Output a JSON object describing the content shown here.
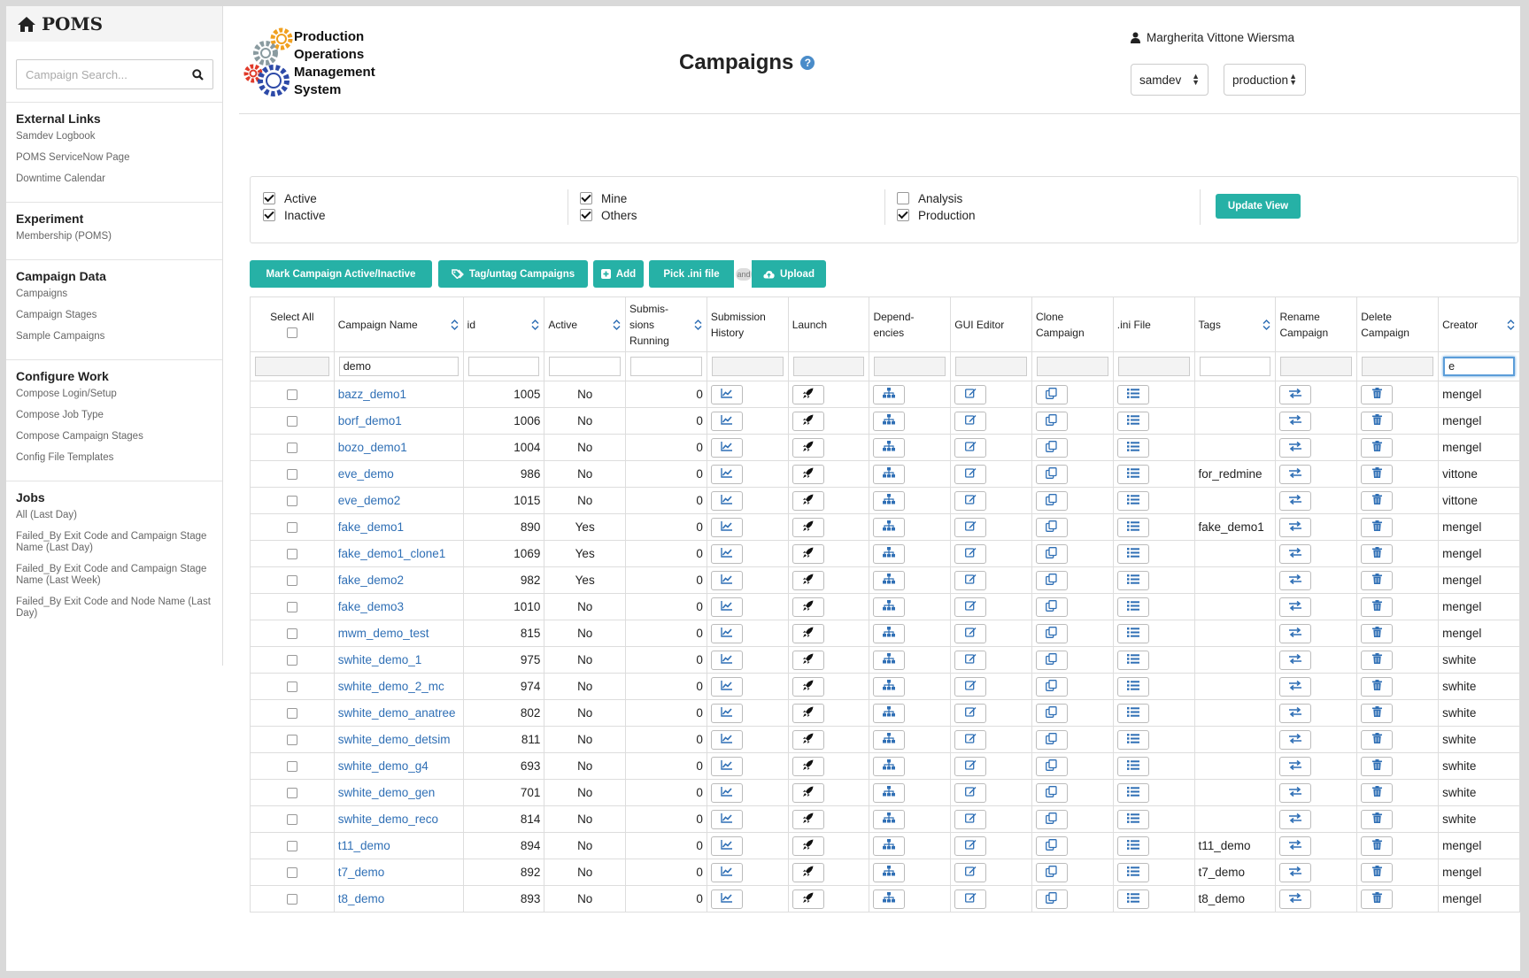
{
  "brand": {
    "title": "POMS"
  },
  "sidebar": {
    "search_placeholder": "Campaign Search...",
    "sections": [
      {
        "title": "External Links",
        "items": [
          "Samdev Logbook",
          "POMS ServiceNow Page",
          "Downtime Calendar"
        ]
      },
      {
        "title": "Experiment",
        "items": [
          "Membership (POMS)"
        ]
      },
      {
        "title": "Campaign Data",
        "items": [
          "Campaigns",
          "Campaign Stages",
          "Sample Campaigns"
        ]
      },
      {
        "title": "Configure Work",
        "items": [
          "Compose Login/Setup",
          "Compose Job Type",
          "Compose Campaign Stages",
          "Config File Templates"
        ]
      },
      {
        "title": "Jobs",
        "items": [
          "All (Last Day)",
          "Failed_By Exit Code and Campaign Stage Name (Last Day)",
          "Failed_By Exit Code and Campaign Stage Name (Last Week)",
          "Failed_By Exit Code and Node Name (Last Day)"
        ]
      }
    ]
  },
  "header": {
    "logo_lines": [
      "Production",
      "Operations",
      "Management",
      "System"
    ],
    "page_title": "Campaigns",
    "help_icon": "question-circle-icon",
    "user_name": "Margherita Vittone Wiersma",
    "experiment_select": "samdev",
    "role_select": "production"
  },
  "filters": {
    "groups": [
      [
        {
          "label": "Active",
          "checked": true
        },
        {
          "label": "Inactive",
          "checked": true
        }
      ],
      [
        {
          "label": "Mine",
          "checked": true
        },
        {
          "label": "Others",
          "checked": true
        }
      ],
      [
        {
          "label": "Analysis",
          "checked": false
        },
        {
          "label": "Production",
          "checked": true
        }
      ]
    ],
    "update_label": "Update View"
  },
  "toolbar": {
    "mark_label": "Mark Campaign Active/Inactive",
    "tag_label": "Tag/untag Campaigns",
    "add_label": "Add",
    "pick_label": "Pick .ini file",
    "and_label": "and",
    "upload_label": "Upload"
  },
  "table": {
    "headers": {
      "select_all": "Select All",
      "name": "Campaign Name",
      "id": "id",
      "active": "Active",
      "running": [
        "Submis-",
        "sions",
        "Running"
      ],
      "history": [
        "Submission",
        "History"
      ],
      "launch": "Launch",
      "deps": [
        "Depend-",
        "encies"
      ],
      "gui": "GUI Editor",
      "clone": [
        "Clone",
        "Campaign"
      ],
      "ini": ".ini File",
      "tags": "Tags",
      "rename": [
        "Rename",
        "Campaign"
      ],
      "delete": [
        "Delete",
        "Campaign"
      ],
      "creator": "Creator"
    },
    "filter_values": {
      "name": "demo",
      "creator": "e"
    },
    "rows": [
      {
        "name": "bazz_demo1",
        "id": "1005",
        "active": "No",
        "running": "0",
        "tags": "",
        "creator": "mengel"
      },
      {
        "name": "borf_demo1",
        "id": "1006",
        "active": "No",
        "running": "0",
        "tags": "",
        "creator": "mengel"
      },
      {
        "name": "bozo_demo1",
        "id": "1004",
        "active": "No",
        "running": "0",
        "tags": "",
        "creator": "mengel"
      },
      {
        "name": "eve_demo",
        "id": "986",
        "active": "No",
        "running": "0",
        "tags": "for_redmine",
        "creator": "vittone"
      },
      {
        "name": "eve_demo2",
        "id": "1015",
        "active": "No",
        "running": "0",
        "tags": "",
        "creator": "vittone"
      },
      {
        "name": "fake_demo1",
        "id": "890",
        "active": "Yes",
        "running": "0",
        "tags": "fake_demo1",
        "creator": "mengel"
      },
      {
        "name": "fake_demo1_clone1",
        "id": "1069",
        "active": "Yes",
        "running": "0",
        "tags": "",
        "creator": "mengel"
      },
      {
        "name": "fake_demo2",
        "id": "982",
        "active": "Yes",
        "running": "0",
        "tags": "",
        "creator": "mengel"
      },
      {
        "name": "fake_demo3",
        "id": "1010",
        "active": "No",
        "running": "0",
        "tags": "",
        "creator": "mengel"
      },
      {
        "name": "mwm_demo_test",
        "id": "815",
        "active": "No",
        "running": "0",
        "tags": "",
        "creator": "mengel"
      },
      {
        "name": "swhite_demo_1",
        "id": "975",
        "active": "No",
        "running": "0",
        "tags": "",
        "creator": "swhite"
      },
      {
        "name": "swhite_demo_2_mc",
        "id": "974",
        "active": "No",
        "running": "0",
        "tags": "",
        "creator": "swhite"
      },
      {
        "name": "swhite_demo_anatree",
        "id": "802",
        "active": "No",
        "running": "0",
        "tags": "",
        "creator": "swhite"
      },
      {
        "name": "swhite_demo_detsim",
        "id": "811",
        "active": "No",
        "running": "0",
        "tags": "",
        "creator": "swhite"
      },
      {
        "name": "swhite_demo_g4",
        "id": "693",
        "active": "No",
        "running": "0",
        "tags": "",
        "creator": "swhite"
      },
      {
        "name": "swhite_demo_gen",
        "id": "701",
        "active": "No",
        "running": "0",
        "tags": "",
        "creator": "swhite"
      },
      {
        "name": "swhite_demo_reco",
        "id": "814",
        "active": "No",
        "running": "0",
        "tags": "",
        "creator": "swhite"
      },
      {
        "name": "t11_demo",
        "id": "894",
        "active": "No",
        "running": "0",
        "tags": "t11_demo",
        "creator": "mengel"
      },
      {
        "name": "t7_demo",
        "id": "892",
        "active": "No",
        "running": "0",
        "tags": "t7_demo",
        "creator": "mengel"
      },
      {
        "name": "t8_demo",
        "id": "893",
        "active": "No",
        "running": "0",
        "tags": "t8_demo",
        "creator": "mengel"
      }
    ]
  },
  "colors": {
    "accent": "#26b1a6",
    "link": "#2f6fb5",
    "icon": "#2f6fb5"
  },
  "row_icons": [
    "chart-line-icon",
    "rocket-icon",
    "sitemap-icon",
    "edit-icon",
    "clone-icon",
    "list-icon",
    "exchange-icon",
    "trash-icon"
  ]
}
